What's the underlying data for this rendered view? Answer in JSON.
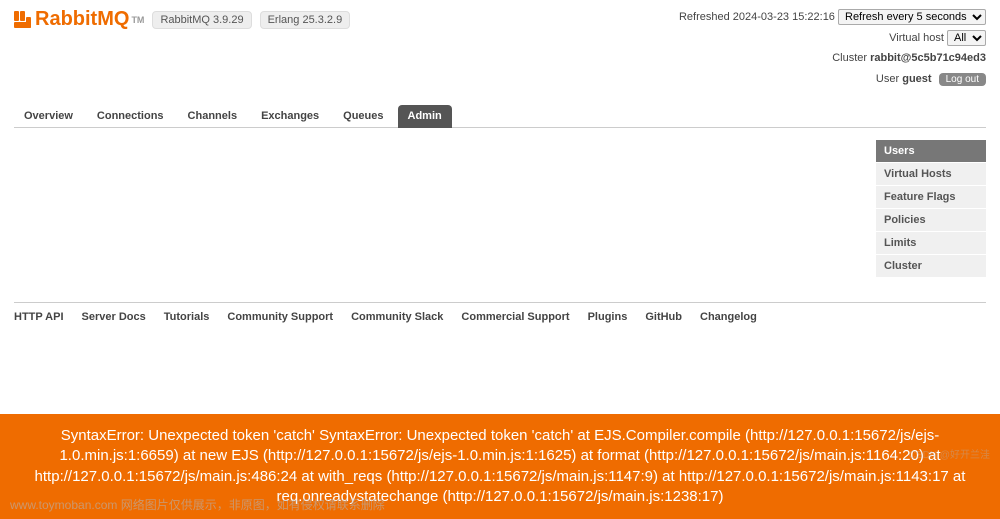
{
  "brand": {
    "name": "RabbitMQ",
    "tm": "TM"
  },
  "versions": {
    "rabbitmq": "RabbitMQ 3.9.29",
    "erlang": "Erlang 25.3.2.9"
  },
  "status": {
    "refreshed_label": "Refreshed",
    "refreshed_time": "2024-03-23 15:22:16",
    "refresh_selected": "Refresh every 5 seconds",
    "vhost_label": "Virtual host",
    "vhost_selected": "All",
    "cluster_label": "Cluster",
    "cluster_id": "rabbit@5c5b71c94ed3",
    "user_label": "User",
    "user_name": "guest",
    "logout": "Log out"
  },
  "tabs": [
    {
      "label": "Overview"
    },
    {
      "label": "Connections"
    },
    {
      "label": "Channels"
    },
    {
      "label": "Exchanges"
    },
    {
      "label": "Queues"
    },
    {
      "label": "Admin",
      "active": true
    }
  ],
  "rhs": [
    {
      "label": "Users",
      "active": true
    },
    {
      "label": "Virtual Hosts"
    },
    {
      "label": "Feature Flags"
    },
    {
      "label": "Policies"
    },
    {
      "label": "Limits"
    },
    {
      "label": "Cluster"
    }
  ],
  "footer": [
    "HTTP API",
    "Server Docs",
    "Tutorials",
    "Community Support",
    "Community Slack",
    "Commercial Support",
    "Plugins",
    "GitHub",
    "Changelog"
  ],
  "error": "SyntaxError: Unexpected token 'catch' SyntaxError: Unexpected token 'catch' at EJS.Compiler.compile (http://127.0.0.1:15672/js/ejs-1.0.min.js:1:6659) at new EJS (http://127.0.0.1:15672/js/ejs-1.0.min.js:1:1625) at format (http://127.0.0.1:15672/js/main.js:1164:20) at http://127.0.0.1:15672/js/main.js:486:24 at with_reqs (http://127.0.0.1:15672/js/main.js:1147:9) at http://127.0.0.1:15672/js/main.js:1143:17 at req.onreadystatechange (http://127.0.0.1:15672/js/main.js:1238:17)",
  "watermarks": {
    "left": "www.toymoban.com 网络图片仅供展示，非原图，如有侵权请联系删除",
    "right": "CSDN @好开兰洼"
  }
}
